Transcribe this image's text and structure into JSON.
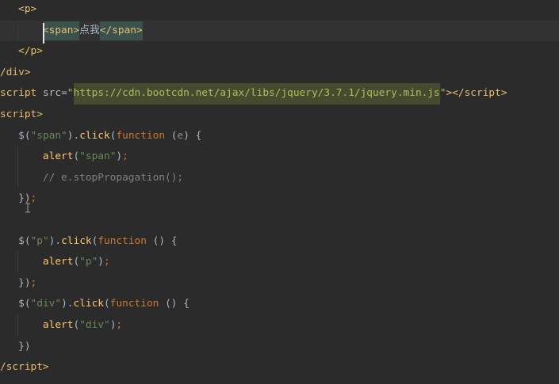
{
  "editor": {
    "lines": [
      [
        "<p>"
      ],
      [
        "<span>",
        "点我",
        "</span>"
      ],
      [
        "</p>"
      ],
      [
        "/div>"
      ],
      [
        "script",
        " src",
        "=",
        "\"",
        "https://cdn.bootcdn.net/ajax/libs/jquery/3.7.1/jquery.min.js",
        "\"",
        "></script>"
      ],
      [
        "script>"
      ],
      [
        "$(",
        "\"span\"",
        ").",
        "click",
        "(",
        "function",
        " (",
        "e",
        ") {"
      ],
      [
        "alert",
        "(",
        "\"span\"",
        ")",
        ";"
      ],
      [
        "// e.stopPropagation();"
      ],
      [
        "})",
        ";"
      ],
      [],
      [
        "$(",
        "\"p\"",
        ").",
        "click",
        "(",
        "function",
        " () {"
      ],
      [
        "alert",
        "(",
        "\"p\"",
        ")",
        ";"
      ],
      [
        "})",
        ";"
      ],
      [
        "$(",
        "\"div\"",
        ").",
        "click",
        "(",
        "function",
        " () {"
      ],
      [
        "alert",
        "(",
        "\"div\"",
        ")",
        ";"
      ],
      [
        "})"
      ],
      [
        "/script>"
      ]
    ]
  },
  "icons": {
    "mouse_cursor": "text-cursor-icon"
  },
  "theme": {
    "background": "#2B2B2B",
    "current_line": "#323232",
    "tag": "#E8BF6A",
    "attribute": "#BABABA",
    "attribute_value": "#A5C25C",
    "url_highlight": "#474A2E",
    "tag_match": "#3B514D",
    "text": "#A9B7C6",
    "string": "#6A8759",
    "keyword": "#CC7832",
    "function_call": "#FFC66D",
    "comment": "#808080",
    "parameter": "#8A8A8A",
    "indent_guide": "#3C3C3C",
    "caret": "#E6E6E6"
  }
}
